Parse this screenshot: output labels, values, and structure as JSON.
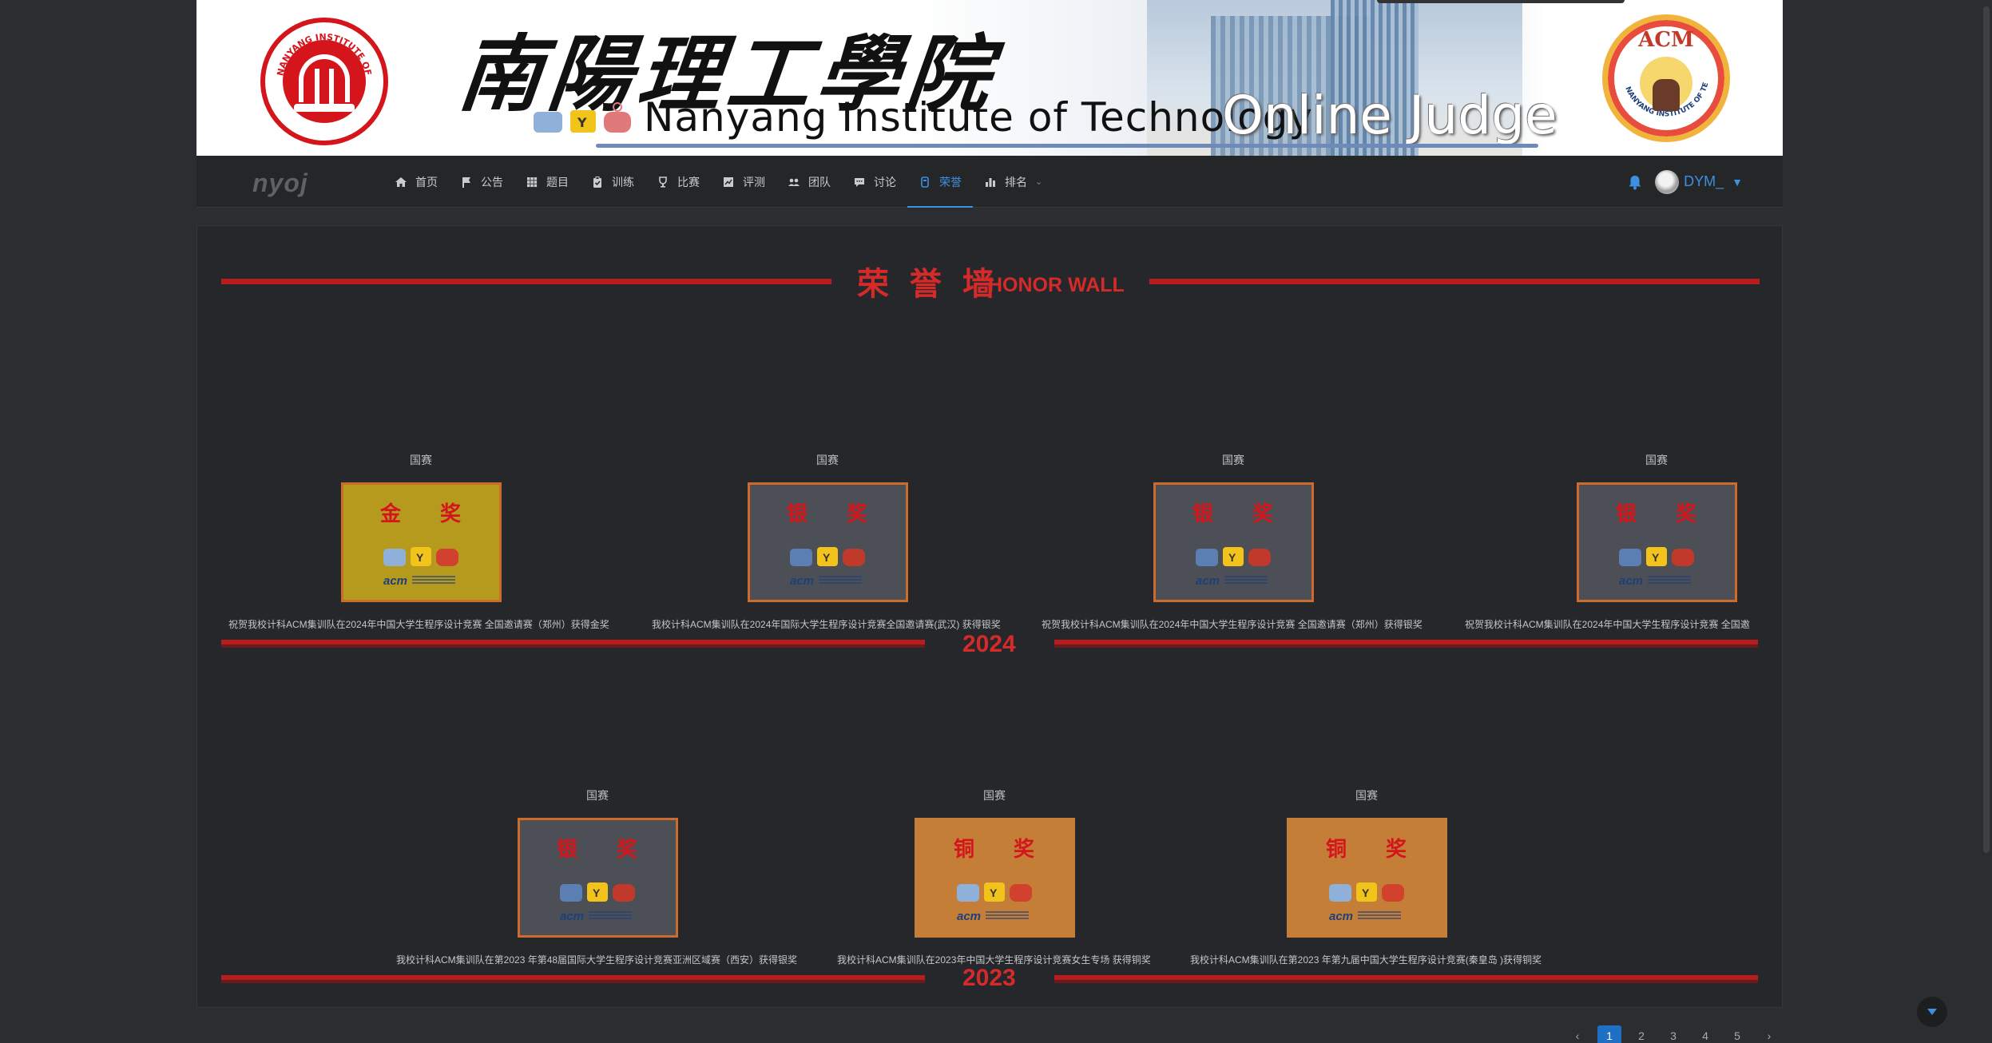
{
  "banner": {
    "cn_title": "南陽理工學院",
    "en_title": "Nanyang Institute of Technology",
    "oj_title": "Online Judge",
    "seal_text": "NANYANG INSTITUTE OF TECHNOLOGY",
    "acm_logo_text": "ACM",
    "acm_ring_text": "NANYANG INSTITUTE OF TECHNOLOGY"
  },
  "navbar": {
    "brand": "nyoj",
    "items": [
      {
        "label": "首页",
        "icon": "home-icon"
      },
      {
        "label": "公告",
        "icon": "flag-icon"
      },
      {
        "label": "题目",
        "icon": "grid-icon"
      },
      {
        "label": "训练",
        "icon": "clipboard-icon"
      },
      {
        "label": "比赛",
        "icon": "trophy-icon"
      },
      {
        "label": "评测",
        "icon": "chart-icon"
      },
      {
        "label": "团队",
        "icon": "team-icon"
      },
      {
        "label": "讨论",
        "icon": "comment-icon"
      },
      {
        "label": "荣誉",
        "icon": "medal-icon",
        "active": true
      },
      {
        "label": "排名",
        "icon": "bar-chart-icon",
        "dropdown": true
      }
    ],
    "username": "DYM_"
  },
  "honor": {
    "title": "荣 誉 墙",
    "subtitle": "HONOR WALL"
  },
  "years": [
    {
      "year": "2024",
      "cards": [
        {
          "kind": "国赛",
          "award": "金 奖",
          "tier": "gold",
          "caption": "祝贺我校计科ACM集训队在2024年中国大学生程序设计竞赛 全国邀请赛（郑州）获得金奖"
        },
        {
          "kind": "国赛",
          "award": "银 奖",
          "tier": "silver",
          "caption": "我校计科ACM集训队在2024年国际大学生程序设计竞赛全国邀请赛(武汉) 获得银奖"
        },
        {
          "kind": "国赛",
          "award": "银 奖",
          "tier": "silver",
          "caption": "祝贺我校计科ACM集训队在2024年中国大学生程序设计竞赛 全国邀请赛（郑州）获得银奖"
        },
        {
          "kind": "国赛",
          "award": "银 奖",
          "tier": "silver",
          "caption": "祝贺我校计科ACM集训队在2024年中国大学生程序设计竞赛 全国邀"
        }
      ]
    },
    {
      "year": "2023",
      "cards": [
        {
          "kind": "国赛",
          "award": "银 奖",
          "tier": "silver",
          "caption": "我校计科ACM集训队在第2023 年第48届国际大学生程序设计竞赛亚洲区域赛（西安）获得银奖"
        },
        {
          "kind": "国赛",
          "award": "铜 奖",
          "tier": "bronze",
          "caption": "我校计科ACM集训队在2023年中国大学生程序设计竞赛女生专场 获得铜奖"
        },
        {
          "kind": "国赛",
          "award": "铜 奖",
          "tier": "bronze",
          "caption": "我校计科ACM集训队在第2023 年第九届中国大学生程序设计竞赛(秦皇岛 )获得铜奖"
        }
      ]
    }
  ],
  "pagination": {
    "prev": "‹",
    "pages": [
      "1",
      "2",
      "3",
      "4",
      "5"
    ],
    "next": "›",
    "current": "1"
  },
  "colors": {
    "accent": "#3d8fe0",
    "honor_red": "#d42a2a",
    "gold": "#b59a1e",
    "silver": "#4c4f55",
    "bronze": "#c57e38"
  }
}
